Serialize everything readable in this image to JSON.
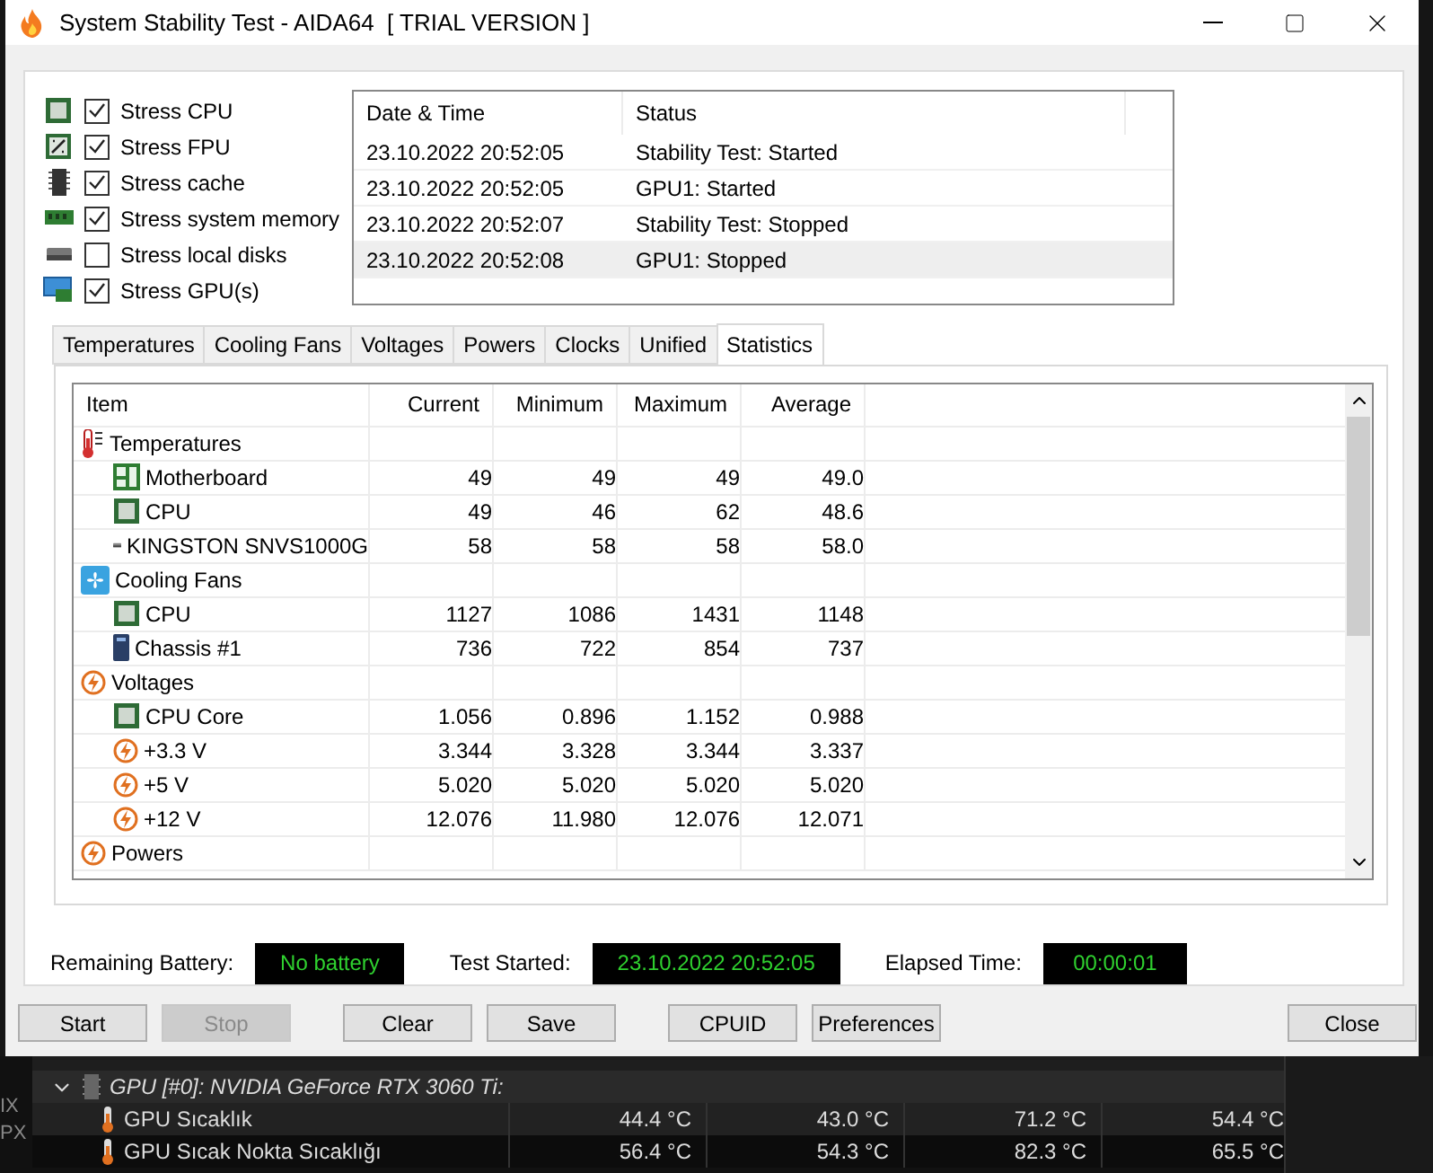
{
  "window": {
    "title": "System Stability Test - AIDA64  [ TRIAL VERSION ]"
  },
  "stress_options": [
    {
      "label": "Stress CPU",
      "checked": true
    },
    {
      "label": "Stress FPU",
      "checked": true
    },
    {
      "label": "Stress cache",
      "checked": true
    },
    {
      "label": "Stress system memory",
      "checked": true
    },
    {
      "label": "Stress local disks",
      "checked": false
    },
    {
      "label": "Stress GPU(s)",
      "checked": true
    }
  ],
  "log": {
    "columns": [
      "Date & Time",
      "Status"
    ],
    "rows": [
      {
        "date": "23.10.2022 20:52:05",
        "status": "Stability Test: Started",
        "selected": false
      },
      {
        "date": "23.10.2022 20:52:05",
        "status": "GPU1: Started",
        "selected": false
      },
      {
        "date": "23.10.2022 20:52:07",
        "status": "Stability Test: Stopped",
        "selected": false
      },
      {
        "date": "23.10.2022 20:52:08",
        "status": "GPU1: Stopped",
        "selected": true
      }
    ]
  },
  "tabs": [
    {
      "label": "Temperatures",
      "selected": false
    },
    {
      "label": "Cooling Fans",
      "selected": false
    },
    {
      "label": "Voltages",
      "selected": false
    },
    {
      "label": "Powers",
      "selected": false
    },
    {
      "label": "Clocks",
      "selected": false
    },
    {
      "label": "Unified",
      "selected": false
    },
    {
      "label": "Statistics",
      "selected": true
    }
  ],
  "statistics": {
    "columns": [
      "Item",
      "Current",
      "Minimum",
      "Maximum",
      "Average"
    ],
    "groups": [
      {
        "name": "Temperatures",
        "children": [
          {
            "name": "Motherboard",
            "values": [
              "49",
              "49",
              "49",
              "49.0"
            ]
          },
          {
            "name": "CPU",
            "values": [
              "49",
              "46",
              "62",
              "48.6"
            ]
          },
          {
            "name": "KINGSTON SNVS1000G",
            "values": [
              "58",
              "58",
              "58",
              "58.0"
            ]
          }
        ]
      },
      {
        "name": "Cooling Fans",
        "children": [
          {
            "name": "CPU",
            "values": [
              "1127",
              "1086",
              "1431",
              "1148"
            ]
          },
          {
            "name": "Chassis #1",
            "values": [
              "736",
              "722",
              "854",
              "737"
            ]
          }
        ]
      },
      {
        "name": "Voltages",
        "children": [
          {
            "name": "CPU Core",
            "values": [
              "1.056",
              "0.896",
              "1.152",
              "0.988"
            ]
          },
          {
            "name": "+3.3 V",
            "values": [
              "3.344",
              "3.328",
              "3.344",
              "3.337"
            ]
          },
          {
            "name": "+5 V",
            "values": [
              "5.020",
              "5.020",
              "5.020",
              "5.020"
            ]
          },
          {
            "name": "+12 V",
            "values": [
              "12.076",
              "11.980",
              "12.076",
              "12.071"
            ]
          }
        ]
      },
      {
        "name": "Powers"
      }
    ]
  },
  "status": [
    {
      "label": "Remaining Battery:",
      "value": "No battery"
    },
    {
      "label": "Test Started:",
      "value": "23.10.2022 20:52:05"
    },
    {
      "label": "Elapsed Time:",
      "value": "00:00:01"
    }
  ],
  "button_groups": [
    {
      "buttons": [
        {
          "label": "Start",
          "disabled": false
        },
        {
          "label": "Stop",
          "disabled": true
        }
      ]
    },
    {
      "buttons": [
        {
          "label": "Clear",
          "disabled": false
        },
        {
          "label": "Save",
          "disabled": false
        }
      ]
    },
    {
      "buttons": [
        {
          "label": "CPUID",
          "disabled": false
        },
        {
          "label": "Preferences",
          "disabled": false
        }
      ]
    },
    {
      "buttons": [
        {
          "label": "Close",
          "disabled": false
        }
      ]
    }
  ],
  "background_app": {
    "edge_fragments": [
      "IX",
      "PX"
    ],
    "node": {
      "label": "GPU [#0]: NVIDIA GeForce RTX 3060 Ti:",
      "expanded": true
    },
    "rows": [
      {
        "name": "GPU Sıcaklık",
        "values": [
          "44.4 °C",
          "43.0 °C",
          "71.2 °C",
          "54.4 °C"
        ]
      },
      {
        "name": "GPU Sıcak Nokta Sıcaklığı",
        "values": [
          "56.4 °C",
          "54.3 °C",
          "82.3 °C",
          "65.5 °C"
        ]
      }
    ]
  }
}
